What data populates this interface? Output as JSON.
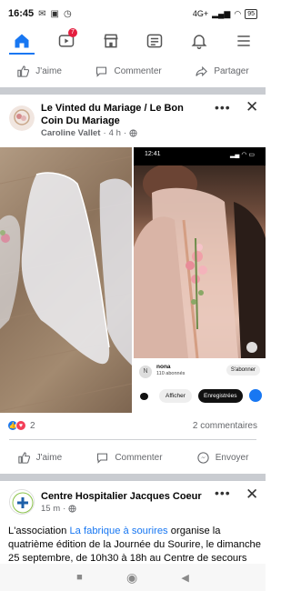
{
  "status_bar": {
    "time": "16:45",
    "battery": "95",
    "network": "4G+"
  },
  "nav": {
    "items": [
      {
        "name": "home",
        "active": true
      },
      {
        "name": "watch",
        "badge": "7"
      },
      {
        "name": "marketplace"
      },
      {
        "name": "news"
      },
      {
        "name": "notifications"
      },
      {
        "name": "menu"
      }
    ]
  },
  "top_actions": {
    "like": "J'aime",
    "comment": "Commenter",
    "share": "Partager"
  },
  "post1": {
    "group": "Le Vinted du Mariage / Le Bon Coin Du Mariage",
    "author": "Caroline Vallet",
    "time": "4 h",
    "privacy_icon": "globe-icon",
    "screenshot": {
      "time": "12:41",
      "username": "nona",
      "followers": "110 abonnés",
      "subscribe": "S'abonner",
      "show": "Afficher",
      "saved": "Enregistrées"
    },
    "reactions_count": "2",
    "comments_count": "2 commentaires",
    "like": "J'aime",
    "comment": "Commenter",
    "send": "Envoyer"
  },
  "post2": {
    "page": "Centre Hospitalier Jacques Coeur",
    "time": "15 m",
    "text_before": "L'association ",
    "link": "La fabrique à sourires",
    "text_after": " organise la quatrième édition de la Journée du Sourire, le dimanche 25 septembre, de 10h30 à 18h au Centre de secours des"
  },
  "colors": {
    "accent": "#1877f2",
    "separator": "#c9ccd1",
    "secondary_text": "#65676b"
  }
}
